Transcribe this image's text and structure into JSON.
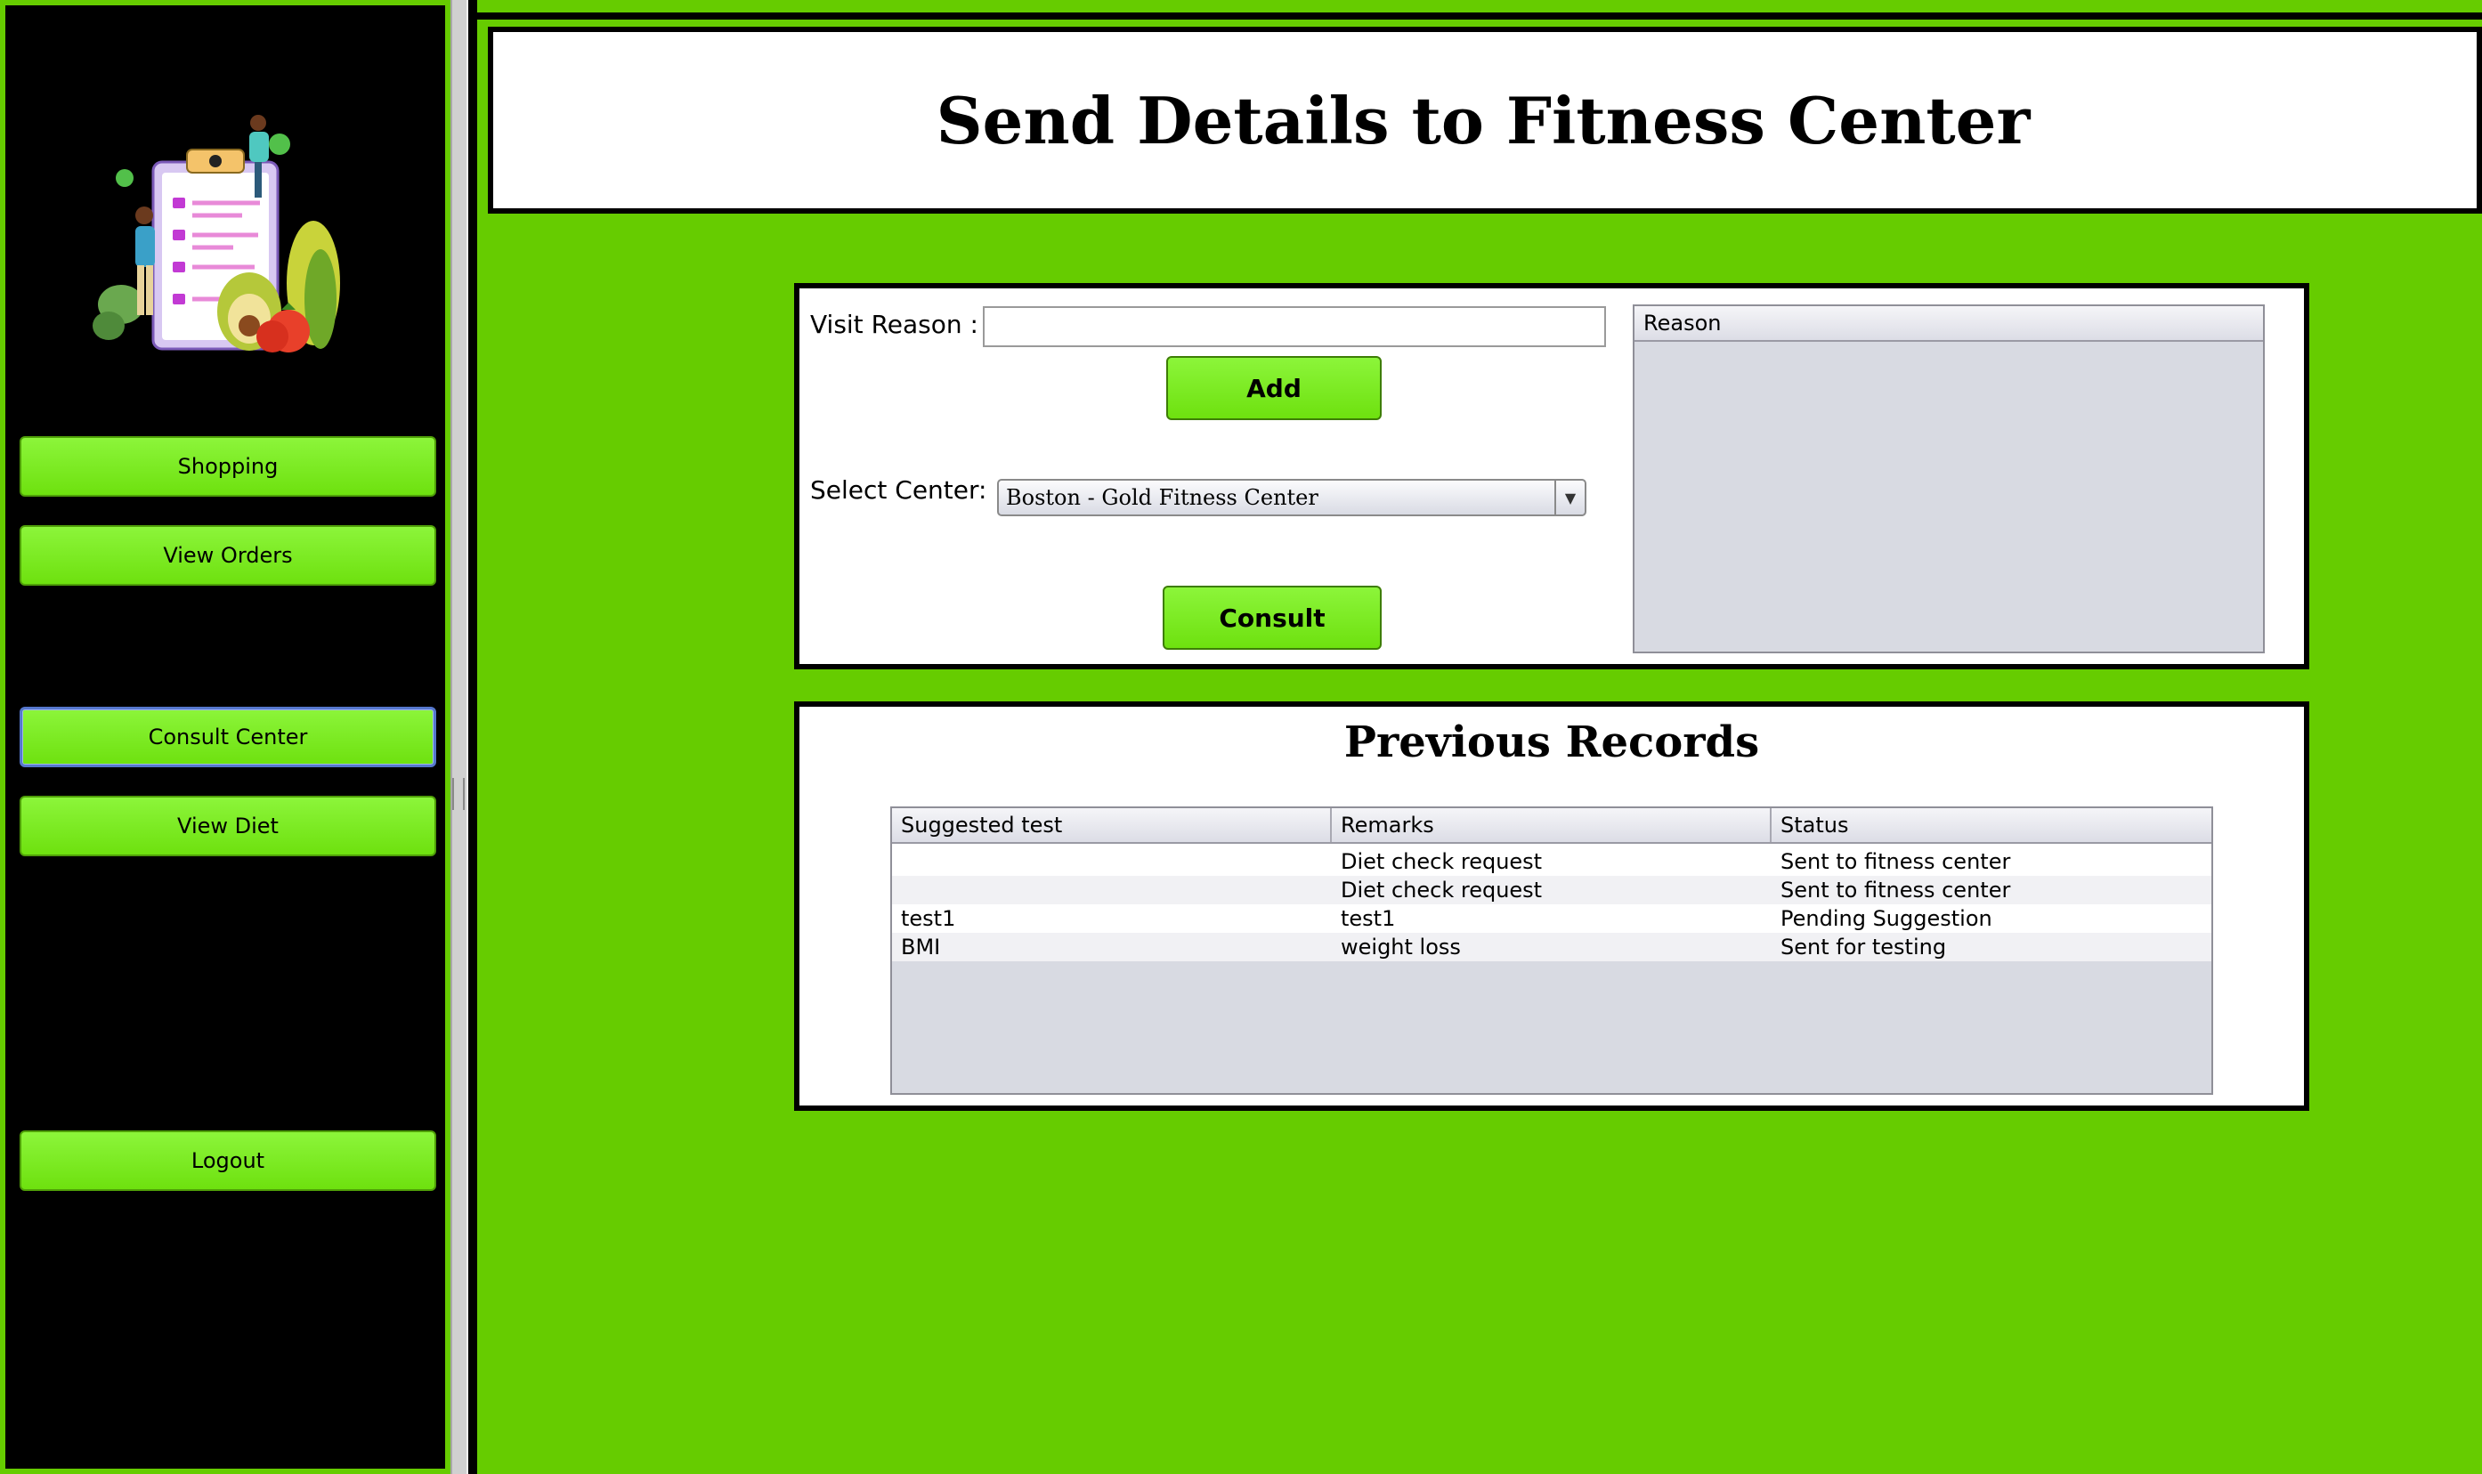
{
  "sidebar": {
    "logo_icon": "diet-checklist-illustration",
    "items": [
      {
        "label": "Shopping"
      },
      {
        "label": "View Orders"
      },
      {
        "label": "Consult Center"
      },
      {
        "label": "View Diet"
      },
      {
        "label": "Logout"
      }
    ]
  },
  "header": {
    "title": "Send Details to Fitness Center"
  },
  "form": {
    "visit_reason_label": "Visit Reason :",
    "visit_reason_value": "",
    "add_label": "Add",
    "select_center_label": "Select Center:",
    "selected_center": "Boston - Gold Fitness Center",
    "dropdown_icon": "chevron-down-icon",
    "consult_label": "Consult",
    "reason_table": {
      "columns": [
        "Reason"
      ],
      "rows": []
    }
  },
  "records": {
    "title": "Previous Records",
    "columns": [
      "Suggested test",
      "Remarks",
      "Status"
    ],
    "rows": [
      [
        "",
        "Diet check request",
        "Sent to fitness center"
      ],
      [
        "",
        "Diet check request",
        "Sent to fitness center"
      ],
      [
        "test1",
        "test1",
        "Pending Suggestion"
      ],
      [
        "BMI",
        "weight loss",
        "Sent for testing"
      ]
    ]
  },
  "colors": {
    "background": "#66cc00",
    "sidebar": "#000000",
    "button": "#7ae82a",
    "panel": "#ffffff"
  }
}
